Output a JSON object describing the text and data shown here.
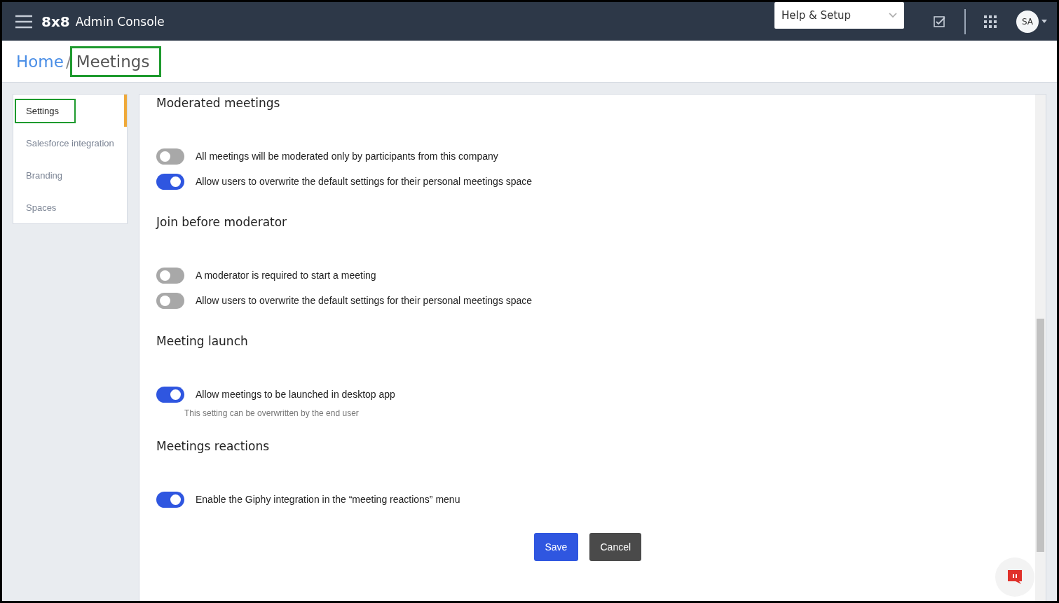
{
  "header": {
    "logo": "8x8",
    "title": "Admin Console",
    "help_menu": {
      "label": "Help & Setup"
    },
    "avatar": {
      "initials": "SA"
    }
  },
  "breadcrumb": {
    "items": [
      {
        "label": "Home",
        "current": false,
        "highlighted": false
      },
      {
        "label": "Meetings",
        "current": true,
        "highlighted": true
      }
    ],
    "separator": "/"
  },
  "sidebar": {
    "items": [
      {
        "label": "Settings",
        "selected": true,
        "highlighted": true
      },
      {
        "label": "Salesforce integration",
        "selected": false,
        "highlighted": false
      },
      {
        "label": "Branding",
        "selected": false,
        "highlighted": false
      },
      {
        "label": "Spaces",
        "selected": false,
        "highlighted": false
      }
    ]
  },
  "sections": [
    {
      "title": "Moderated meetings",
      "settings": [
        {
          "label": "All meetings will be moderated only by participants from this company",
          "on": false
        },
        {
          "label": "Allow users to overwrite the default settings for their personal meetings space",
          "on": true
        }
      ]
    },
    {
      "title": "Join before moderator",
      "settings": [
        {
          "label": "A moderator is required to start a meeting",
          "on": false
        },
        {
          "label": "Allow users to overwrite the default settings for their personal meetings space",
          "on": false
        }
      ]
    },
    {
      "title": "Meeting launch",
      "settings": [
        {
          "label": "Allow meetings to be launched in desktop app",
          "on": true,
          "note": "This setting can be overwritten by the end user"
        }
      ]
    },
    {
      "title": "Meetings reactions",
      "settings": [
        {
          "label": "Enable the Giphy integration in the “meeting reactions” menu",
          "on": true
        }
      ]
    }
  ],
  "buttons": [
    {
      "label": "Save",
      "kind": "primary"
    },
    {
      "label": "Cancel",
      "kind": "secondary"
    }
  ]
}
